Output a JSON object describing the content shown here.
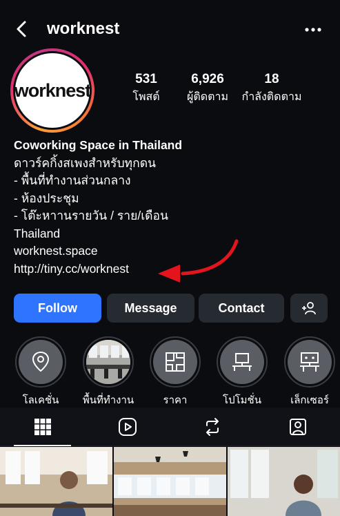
{
  "header": {
    "username": "worknest"
  },
  "profile": {
    "avatar_text": "worknest"
  },
  "stats": [
    {
      "value": "531",
      "label": "โพสต์"
    },
    {
      "value": "6,926",
      "label": "ผู้ติดตาม"
    },
    {
      "value": "18",
      "label": "กำลังติดตาม"
    }
  ],
  "bio": {
    "name": "Coworking Space in Thailand",
    "lines": [
      "ดาวร์คกิ้งสเพงสำหรับทุกดน",
      "- พื้นที่ทำงานส่วนกลาง",
      "- ห้องประชุม",
      "- โต๊ะหาานรายวัน / ราย/เดือน",
      "Thailand",
      "worknest.space",
      "http://tiny.cc/worknest"
    ]
  },
  "actions": {
    "follow": "Follow",
    "message": "Message",
    "contact": "Contact"
  },
  "highlights": [
    {
      "label": "โลเคชั่น",
      "icon": "location-pin-icon"
    },
    {
      "label": "พื้นที่ทำงาน",
      "icon": "office-photo"
    },
    {
      "label": "ราคา",
      "icon": "floorplan-icon"
    },
    {
      "label": "โปโมชั่น",
      "icon": "desk-computer-icon"
    },
    {
      "label": "เล็กเซอร์",
      "icon": "presentation-icon"
    }
  ],
  "tabs": [
    {
      "name": "grid-icon",
      "active": true
    },
    {
      "name": "reels-icon",
      "active": false
    },
    {
      "name": "repost-icon",
      "active": false
    },
    {
      "name": "tagged-icon",
      "active": false
    }
  ],
  "colors": {
    "accent": "#2f74ff",
    "annotation_arrow": "#e3141c",
    "background": "#0b0c10"
  }
}
